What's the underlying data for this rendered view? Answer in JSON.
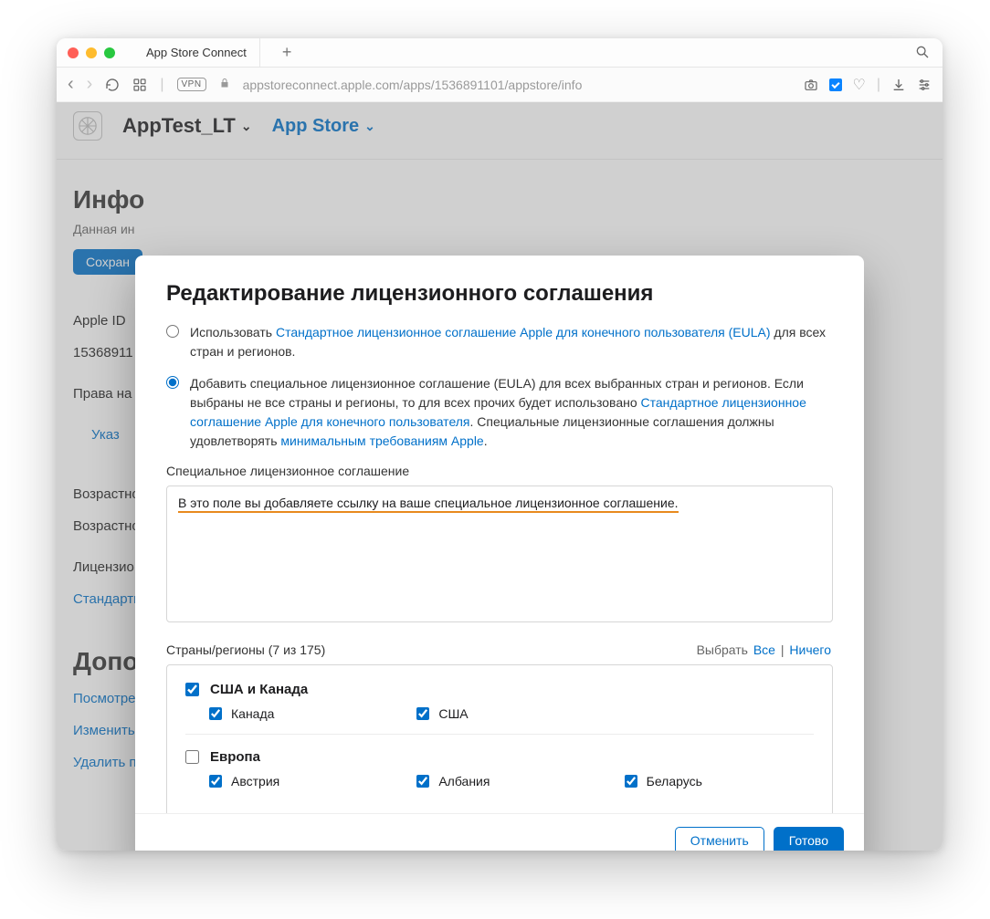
{
  "browser": {
    "tab_title": "App Store Connect",
    "url": "appstoreconnect.apple.com/apps/1536891101/appstore/info",
    "vpn_badge": "VPN"
  },
  "header": {
    "app_name": "AppTest_LT",
    "section": "App Store"
  },
  "page": {
    "heading": "Инфо",
    "subheading": "Данная ин",
    "save_button": "Сохран",
    "apple_id_label": "Apple ID",
    "apple_id_value": "15368911",
    "rights_label": "Права на",
    "specify_link": "Указ",
    "age_label1": "Возрастно",
    "age_label2": "Возрастно",
    "license_label": "Лицензио",
    "standard_link": "Стандартн",
    "extras_heading": "Допо",
    "view_link": "Посмотре",
    "change_link": "Изменить",
    "delete_link": "Удалить п"
  },
  "modal": {
    "title": "Редактирование лицензионного соглашения",
    "option1_prefix": "Использовать ",
    "option1_link": "Стандартное лицензионное соглашение Apple для конечного пользователя (EULA)",
    "option1_suffix": " для всех стран и регионов.",
    "option2_prefix": "Добавить специальное лицензионное соглашение (EULA) для всех выбранных стран и регионов. Если выбраны не все страны и регионы, то для всех прочих будет использовано ",
    "option2_link1": "Стандартное лицензионное соглашение Apple для конечного пользователя",
    "option2_middle": ". Специальные лицензионные соглашения должны удовлетворять ",
    "option2_link2": "минимальным требованиям Apple",
    "option2_suffix": ".",
    "textarea_label": "Специальное лицензионное соглашение",
    "textarea_value": "В это поле вы добавляете ссылку на ваше специальное лицензионное соглашение.",
    "countries_label": "Страны/регионы ",
    "countries_count": "(7 из 175)",
    "select_label": "Выбрать",
    "select_all": "Все",
    "select_none": "Ничего",
    "regions": [
      {
        "name": "США и Канада",
        "checked": true,
        "countries": [
          {
            "name": "Канада",
            "checked": true
          },
          {
            "name": "США",
            "checked": true
          }
        ]
      },
      {
        "name": "Европа",
        "checked": false,
        "countries": [
          {
            "name": "Австрия",
            "checked": true
          },
          {
            "name": "Албания",
            "checked": true
          },
          {
            "name": "Беларусь",
            "checked": true
          }
        ]
      }
    ],
    "cancel": "Отменить",
    "done": "Готово"
  }
}
